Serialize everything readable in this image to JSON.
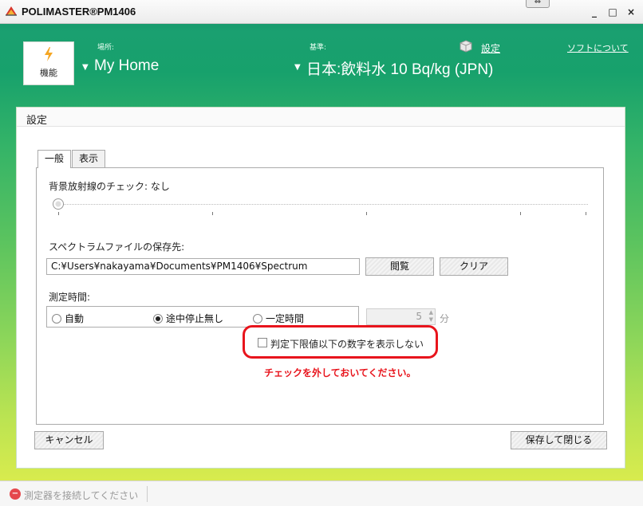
{
  "window": {
    "title": "POLIMASTER®PM1406",
    "restore_glyph": "⇔",
    "minimize_glyph": "_",
    "maximize_glyph": "□",
    "close_glyph": "×"
  },
  "header": {
    "function_button": "機能",
    "location_label": "場所:",
    "location_value": "My Home",
    "standard_label": "基準:",
    "standard_value": "日本:飲料水 10 Bq/kg (JPN)",
    "settings_link": "設定",
    "about_link": "ソフトについて",
    "caret_glyph": "▼"
  },
  "panel": {
    "title": "設定",
    "tabs": [
      {
        "label": "一般",
        "active": true
      },
      {
        "label": "表示",
        "active": false
      }
    ],
    "background_check_label": "背景放射線のチェック: なし",
    "spectrum_save_label": "スペクトラムファイルの保存先:",
    "spectrum_path": "C:¥Users¥nakayama¥Documents¥PM1406¥Spectrum",
    "browse_button": "閲覧",
    "clear_button": "クリア",
    "measure_time_label": "測定時間:",
    "radio_options": [
      {
        "label": "自動",
        "selected": false
      },
      {
        "label": "途中停止無し",
        "selected": true
      },
      {
        "label": "一定時間",
        "selected": false
      }
    ],
    "spin_value": "5",
    "spin_unit": "分",
    "hide_below_limit_checkbox": "判定下限値以下の数字を表示しない",
    "hide_below_limit_checked": false,
    "note_text": "チェックを外しておいてください。",
    "cancel_button": "キャンセル",
    "save_close_button": "保存して閉じる"
  },
  "statusbar": {
    "message": "測定器を接続してください",
    "icon": "error-minus-icon"
  },
  "colors": {
    "highlight": "#e8141c",
    "header_gradient_top": "#0f8a64",
    "header_gradient_bottom": "#e0ee55"
  }
}
